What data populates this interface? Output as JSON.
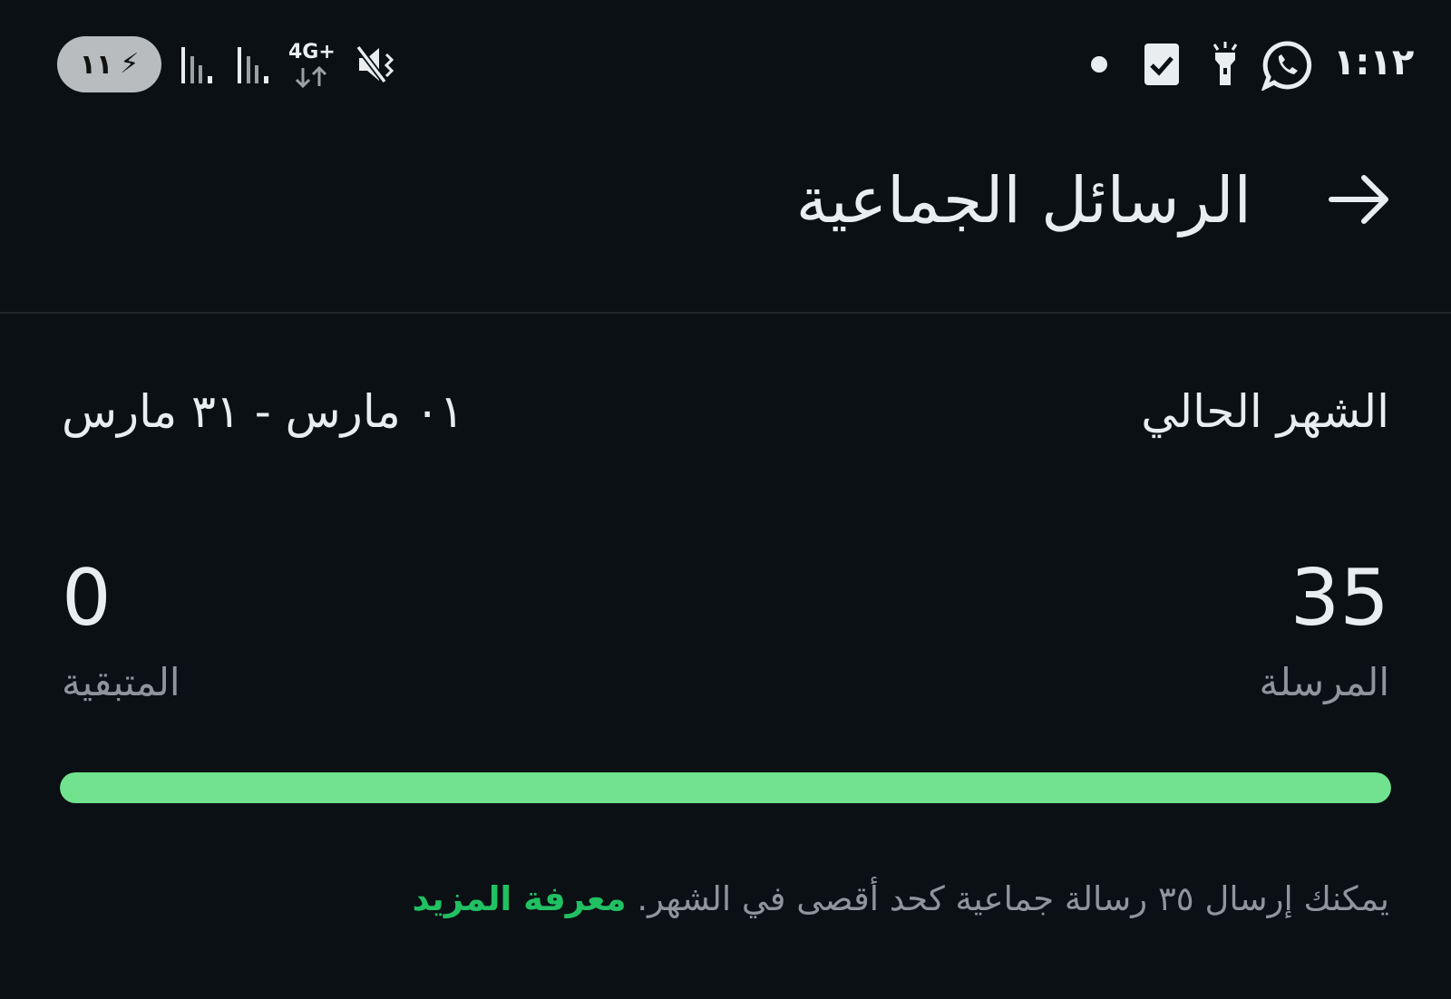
{
  "status_bar": {
    "battery_level": "١١",
    "network_type": "4G+",
    "clock": "١:١٢",
    "icons": [
      "battery-charging-icon",
      "signal-icon",
      "signal-icon",
      "network-data-icon",
      "mute-vibrate-icon",
      "notification-dot-icon",
      "checkbox-notification-icon",
      "flashlight-icon",
      "whatsapp-icon"
    ]
  },
  "header": {
    "title": "الرسائل الجماعية",
    "back_icon": "arrow-right-icon"
  },
  "period": {
    "label": "الشهر الحالي",
    "range": "٠١ مارس - ٣١ مارس"
  },
  "stats": {
    "sent_value": "35",
    "sent_label": "المرسلة",
    "remaining_value": "0",
    "remaining_label": "المتبقية"
  },
  "progress": {
    "fraction_used": 1.0
  },
  "footnote": {
    "text": "يمكنك إرسال ٣٥ رسالة جماعية كحد أقصى في الشهر.",
    "link": "معرفة المزيد"
  },
  "colors": {
    "background": "#0b1014",
    "accent": "#21c063",
    "progress": "#71e28d",
    "muted_text": "#8e969b"
  }
}
